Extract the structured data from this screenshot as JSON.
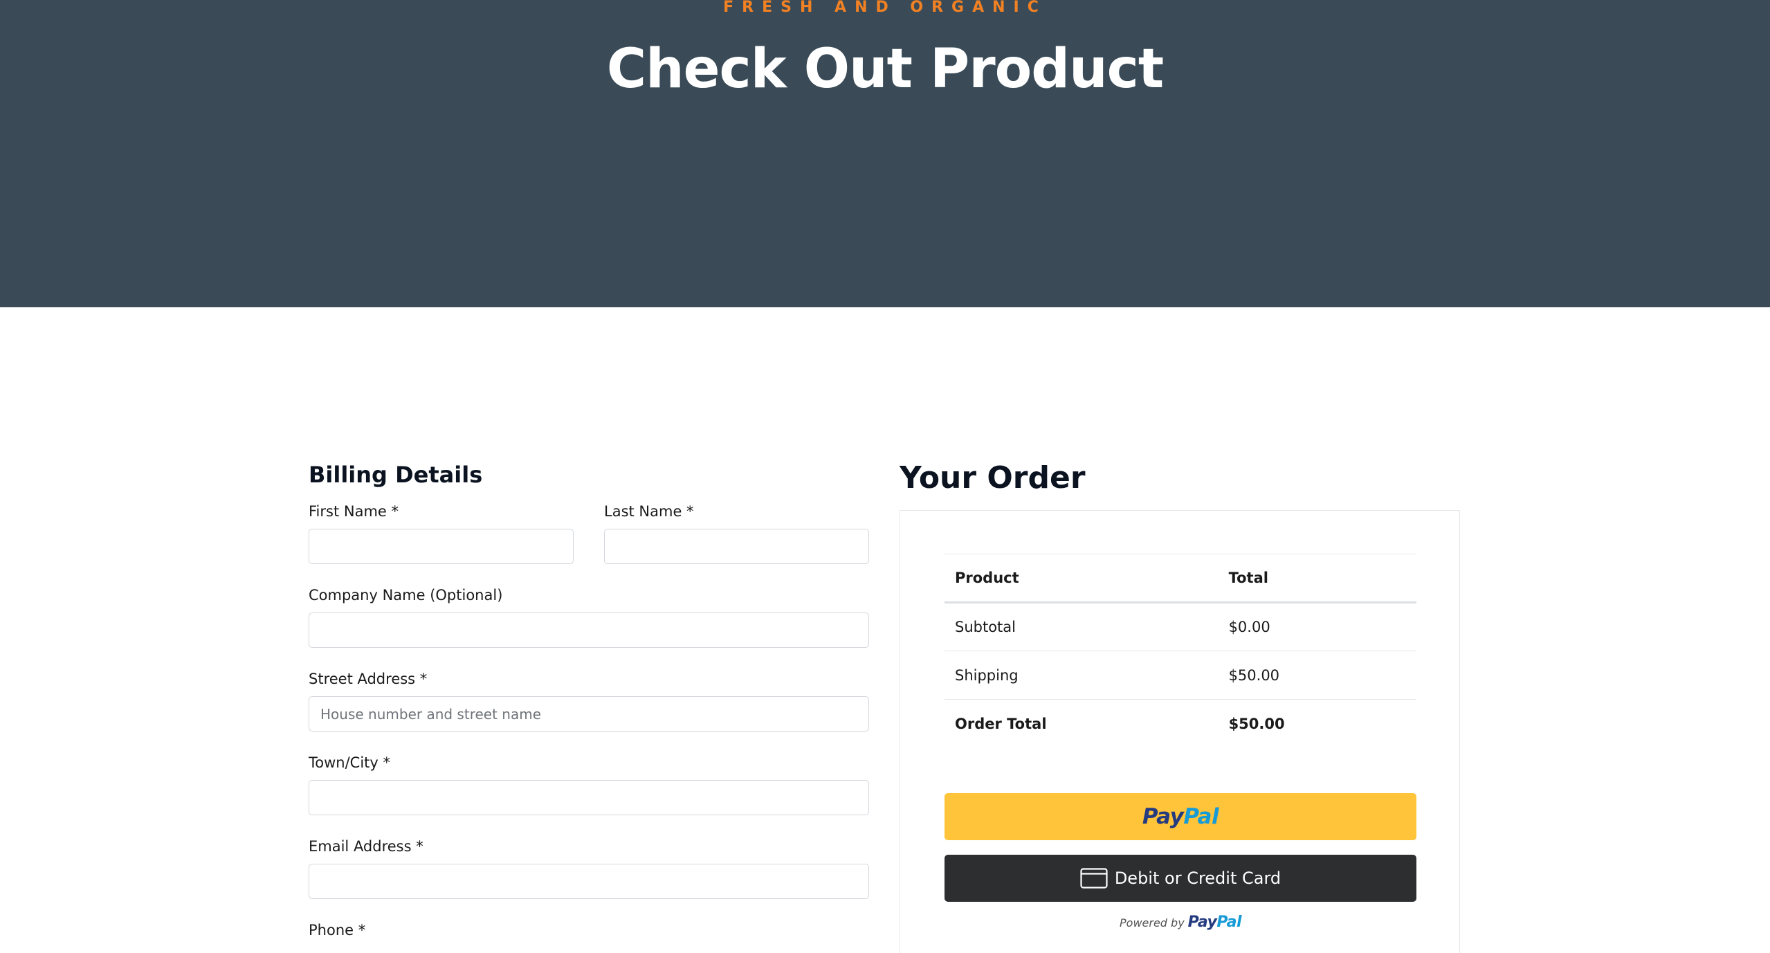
{
  "hero": {
    "eyebrow": "FRESH AND ORGANIC",
    "title": "Check Out Product",
    "background": "#3a4b57",
    "accent": "#f28123"
  },
  "billing": {
    "heading": "Billing Details",
    "first_name": {
      "label": "First Name *",
      "value": "",
      "placeholder": ""
    },
    "last_name": {
      "label": "Last Name *",
      "value": "",
      "placeholder": ""
    },
    "company": {
      "label": "Company Name (Optional)",
      "value": "",
      "placeholder": ""
    },
    "street": {
      "label": "Street Address *",
      "value": "",
      "placeholder": "House number and street name"
    },
    "town": {
      "label": "Town/City *",
      "value": "",
      "placeholder": ""
    },
    "email": {
      "label": "Email Address *",
      "value": "",
      "placeholder": ""
    },
    "phone": {
      "label": "Phone *"
    }
  },
  "order": {
    "heading": "Your Order",
    "columns": {
      "product": "Product",
      "total": "Total"
    },
    "rows": [
      {
        "label": "Subtotal",
        "value": "$0.00"
      },
      {
        "label": "Shipping",
        "value": "$50.00"
      }
    ],
    "grand_total": {
      "label": "Order Total",
      "value": "$50.00"
    }
  },
  "payment": {
    "paypal_pay": "Pay",
    "paypal_pal": "Pal",
    "paypal_color": "#ffc439",
    "card_label": "Debit or Credit Card",
    "card_icon": "credit-card-icon",
    "powered_by": "Powered by",
    "powered_pay": "Pay",
    "powered_pal": "Pal"
  }
}
